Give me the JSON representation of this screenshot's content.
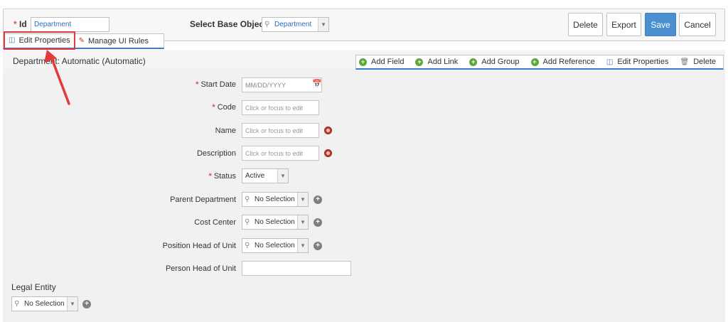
{
  "header": {
    "id_label": "Id",
    "id_required": "*",
    "id_value": "Department",
    "base_object_label": "Select Base Object",
    "base_object_value": "Department",
    "buttons": {
      "delete": "Delete",
      "export": "Export",
      "save": "Save",
      "cancel": "Cancel"
    }
  },
  "context_toolbar": {
    "edit_properties": "Edit Properties",
    "manage_ui_rules": "Manage UI Rules"
  },
  "section": {
    "title": "Department: Automatic (Automatic)"
  },
  "field_toolbar": {
    "add_field": "Add Field",
    "add_link": "Add Link",
    "add_group": "Add Group",
    "add_reference": "Add Reference",
    "edit_properties": "Edit Properties",
    "delete": "Delete"
  },
  "fields": {
    "start_date": {
      "label": "Start Date",
      "placeholder": "MM/DD/YYYY",
      "required": "*"
    },
    "code": {
      "label": "Code",
      "placeholder": "Click or focus to edit",
      "required": "*"
    },
    "name": {
      "label": "Name",
      "placeholder": "Click or focus to edit"
    },
    "description": {
      "label": "Description",
      "placeholder": "Click or focus to edit"
    },
    "status": {
      "label": "Status",
      "value": "Active",
      "required": "*"
    },
    "parent_department": {
      "label": "Parent Department",
      "value": "No Selection"
    },
    "cost_center": {
      "label": "Cost Center",
      "value": "No Selection"
    },
    "position_head": {
      "label": "Position Head of Unit",
      "value": "No Selection"
    },
    "person_head": {
      "label": "Person Head of Unit",
      "value": ""
    },
    "legal_entity": {
      "label": "Legal Entity",
      "value": "No Selection"
    }
  },
  "colors": {
    "accent": "#3a7bd5",
    "save_button": "#4a90d0",
    "highlight": "#e23b3b",
    "add_icon": "#5aa838"
  }
}
